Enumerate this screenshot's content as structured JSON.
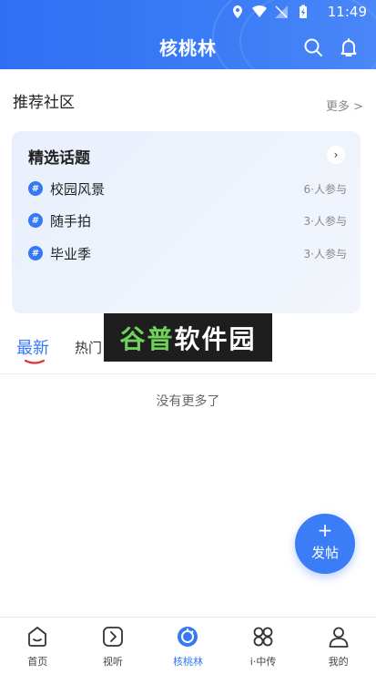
{
  "status_bar": {
    "time": "11:49"
  },
  "header": {
    "title": "核桃林",
    "icons": [
      "search-icon",
      "bell-icon"
    ]
  },
  "recommended": {
    "title": "推荐社区",
    "more_label": "更多 >"
  },
  "topic_card": {
    "title": "精选话题",
    "topics": [
      {
        "hash": "#",
        "name": "校园风景",
        "count": "6·人参与"
      },
      {
        "hash": "#",
        "name": "随手拍",
        "count": "3·人参与"
      },
      {
        "hash": "#",
        "name": "毕业季",
        "count": "3·人参与"
      }
    ]
  },
  "tabs": {
    "latest": "最新",
    "hot": "热门"
  },
  "watermark": {
    "part1": "谷普",
    "part2": "软件园"
  },
  "feed": {
    "empty_text": "没有更多了"
  },
  "fab": {
    "plus": "+",
    "label": "发帖"
  },
  "bottom_nav": {
    "items": [
      {
        "label": "首页",
        "icon": "home-icon"
      },
      {
        "label": "视听",
        "icon": "play-icon"
      },
      {
        "label": "核桃林",
        "icon": "walnut-icon"
      },
      {
        "label": "i·中传",
        "icon": "apps-icon"
      },
      {
        "label": "我的",
        "icon": "user-icon"
      }
    ],
    "active_index": 2
  },
  "colors": {
    "accent": "#3478f6",
    "header": "#2f6ff3"
  }
}
